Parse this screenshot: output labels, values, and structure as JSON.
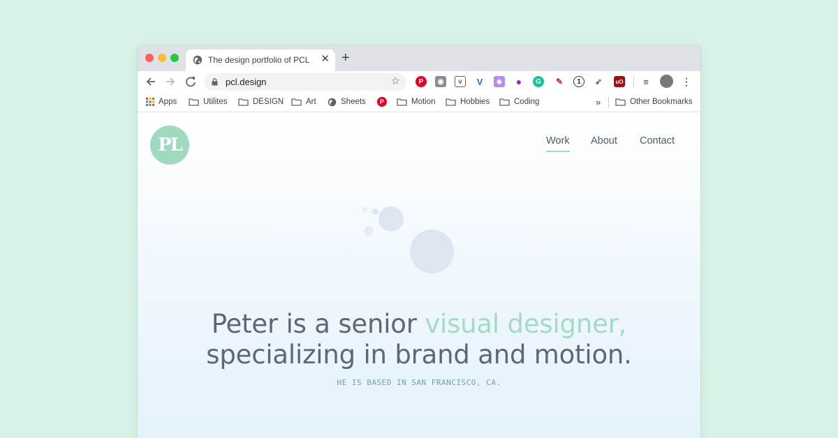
{
  "browser": {
    "tab": {
      "title": "The design portfolio of PCL",
      "icon": "globe-icon"
    },
    "url": "pcl.design",
    "bookmarks": [
      "Apps",
      "Utilites",
      "DESIGN",
      "Art",
      "Sheets",
      "Motion",
      "Hobbies",
      "Coding"
    ],
    "other_bookmarks": "Other Bookmarks",
    "overflow_label": "»"
  },
  "site": {
    "logo_text": "PL",
    "nav": [
      {
        "label": "Work",
        "active": true
      },
      {
        "label": "About",
        "active": false
      },
      {
        "label": "Contact",
        "active": false
      }
    ],
    "headline_part1": "Peter is a senior ",
    "headline_accent": "visual designer,",
    "headline_part2": "specializing in brand and motion.",
    "subline": "HE IS BASED IN SAN FRANCISCO, CA."
  },
  "colors": {
    "background": "#d6f3e6",
    "brand_mint": "#9ed9c0",
    "headline_gray": "#5c6875",
    "accent": "#a3dcc4",
    "subline_blue": "#6fa0b8"
  }
}
